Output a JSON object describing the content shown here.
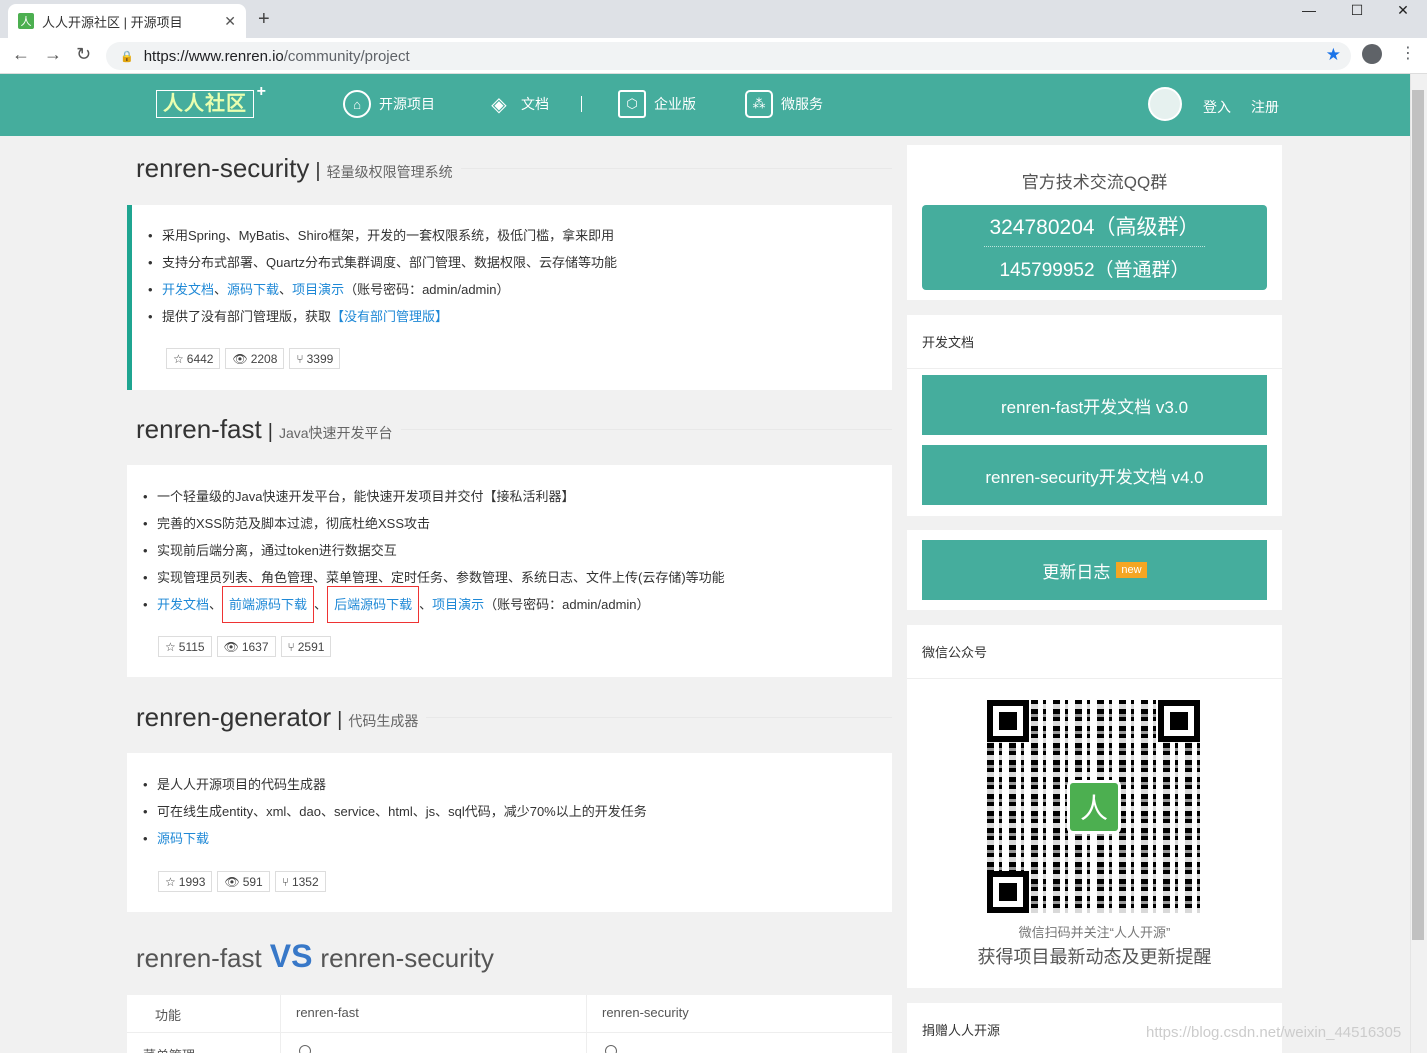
{
  "browser": {
    "tab_title": "人人开源社区 | 开源项目",
    "tab_icon": "人",
    "url_host": "https://www.renren.io",
    "url_path": "/community/project"
  },
  "header": {
    "logo": "人人社区",
    "logo_plus": "+",
    "nav": [
      {
        "label": "开源项目",
        "icon": "github-icon"
      },
      {
        "label": "文档",
        "icon": "layers-icon"
      },
      {
        "label": "企业版",
        "icon": "cube-icon"
      },
      {
        "label": "微服务",
        "icon": "network-icon"
      }
    ],
    "login": "登入",
    "register": "注册"
  },
  "projects": [
    {
      "name": "renren-security",
      "desc": "轻量级权限管理系统",
      "items": [
        "采用Spring、MyBatis、Shiro框架，开发的一套权限系统，极低门槛，拿来即用",
        "支持分布式部署、Quartz分布式集群调度、部门管理、数据权限、云存储等功能"
      ],
      "links": [
        "开发文档",
        "源码下载",
        "项目演示"
      ],
      "links_note": "（账号密码：admin/admin）",
      "extra_prefix": "提供了没有部门管理版，获取",
      "extra_link": "【没有部门管理版】",
      "stars": "6442",
      "views": "2208",
      "forks": "3399"
    },
    {
      "name": "renren-fast",
      "desc": "Java快速开发平台",
      "items": [
        "一个轻量级的Java快速开发平台，能快速开发项目并交付【接私活利器】",
        "完善的XSS防范及脚本过滤，彻底杜绝XSS攻击",
        "实现前后端分离，通过token进行数据交互",
        "实现管理员列表、角色管理、菜单管理、定时任务、参数管理、系统日志、文件上传(云存储)等功能"
      ],
      "links": [
        "开发文档",
        "前端源码下载",
        "后端源码下载",
        "项目演示"
      ],
      "links_note": "（账号密码：admin/admin）",
      "stars": "5115",
      "views": "1637",
      "forks": "2591"
    },
    {
      "name": "renren-generator",
      "desc": "代码生成器",
      "items": [
        "是人人开源项目的代码生成器",
        "可在线生成entity、xml、dao、service、html、js、sql代码，减少70%以上的开发任务"
      ],
      "links": [
        "源码下载"
      ],
      "stars": "1993",
      "views": "591",
      "forks": "1352"
    }
  ],
  "vs": {
    "left": "renren-fast",
    "mid": "VS",
    "right": "renren-security",
    "headers": [
      "功能",
      "renren-fast",
      "renren-security"
    ],
    "row1": "菜单管理"
  },
  "sidebar": {
    "qq_title": "官方技术交流QQ群",
    "qq_high": "324780204（高级群）",
    "qq_normal": "145799952（普通群）",
    "docs_title": "开发文档",
    "doc1": "renren-fast开发文档 v3.0",
    "doc2": "renren-security开发文档 v4.0",
    "changelog": "更新日志",
    "new_badge": "new",
    "wechat_title": "微信公众号",
    "qr_logo": "人",
    "wechat_line1": "微信扫码并关注“人人开源”",
    "wechat_line2": "获得项目最新动态及更新提醒",
    "donate_title": "捐赠人人开源"
  },
  "watermark": "https://blog.csdn.net/weixin_44516305"
}
